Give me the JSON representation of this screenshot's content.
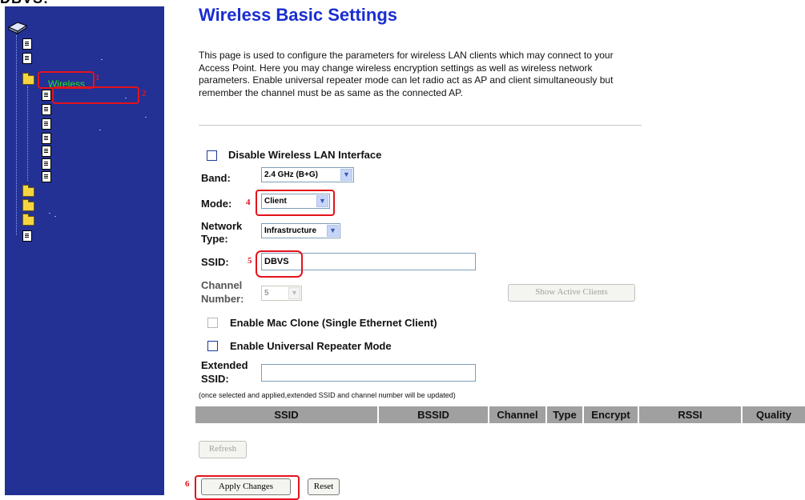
{
  "window": {
    "top_fragment": "DBVS:"
  },
  "sidebar": {
    "tree": [
      {
        "type": "root",
        "icon": "network-device-icon"
      },
      {
        "type": "page",
        "icon": "page-icon"
      },
      {
        "type": "page",
        "icon": "page-icon"
      },
      {
        "type": "folder-open",
        "icon": "folder-open-icon",
        "label": "Wireless"
      },
      {
        "type": "page",
        "icon": "page-icon"
      },
      {
        "type": "page",
        "icon": "page-icon"
      },
      {
        "type": "page",
        "icon": "page-icon"
      },
      {
        "type": "page",
        "icon": "page-icon"
      },
      {
        "type": "page",
        "icon": "page-icon"
      },
      {
        "type": "page",
        "icon": "page-icon"
      },
      {
        "type": "page",
        "icon": "page-icon"
      },
      {
        "type": "folder",
        "icon": "folder-icon"
      },
      {
        "type": "folder",
        "icon": "folder-icon"
      },
      {
        "type": "folder",
        "icon": "folder-icon"
      },
      {
        "type": "page",
        "icon": "page-icon"
      }
    ],
    "wireless_label": "Wireless"
  },
  "annotations": {
    "n1": "1",
    "n2": "2",
    "n4": "4",
    "n5": "5",
    "n6": "6"
  },
  "main": {
    "title": "Wireless Basic Settings",
    "description": "This page is used to configure the parameters for wireless LAN clients which may connect to your Access Point. Here you may change wireless encryption settings as well as wireless network parameters. Enable universal repeater mode can let radio act as AP and client simultaneously but remember the channel must be as same as the connected AP.",
    "disable_wlan_label": "Disable Wireless LAN Interface",
    "band_label": "Band:",
    "band_value": "2.4 GHz (B+G)",
    "mode_label": "Mode:",
    "mode_value": "Client",
    "network_type_label_1": "Network",
    "network_type_label_2": "Type:",
    "network_type_value": "Infrastructure",
    "ssid_label": "SSID:",
    "ssid_value": "DBVS",
    "channel_label_1": "Channel",
    "channel_label_2": "Number:",
    "channel_value": "5",
    "show_clients_button": "Show Active Clients",
    "mac_clone_label": "Enable Mac Clone (Single Ethernet Client)",
    "repeater_label": "Enable Universal Repeater Mode",
    "ext_ssid_label_1": "Extended",
    "ext_ssid_label_2": "SSID:",
    "ext_ssid_value": "",
    "hint": "(once selected and applied,extended SSID and channel number will be updated)",
    "table_headers": [
      "SSID",
      "BSSID",
      "Channel",
      "Type",
      "Encrypt",
      "RSSI",
      "Quality"
    ],
    "refresh_button": "Refresh",
    "apply_button": "Apply Changes",
    "reset_button": "Reset"
  },
  "colors": {
    "sidebar_bg": "#233195",
    "title": "#1a2ed0",
    "annotation": "#e3131b",
    "wireless_label": "#26e61b",
    "table_header": "#a0a0a0"
  }
}
